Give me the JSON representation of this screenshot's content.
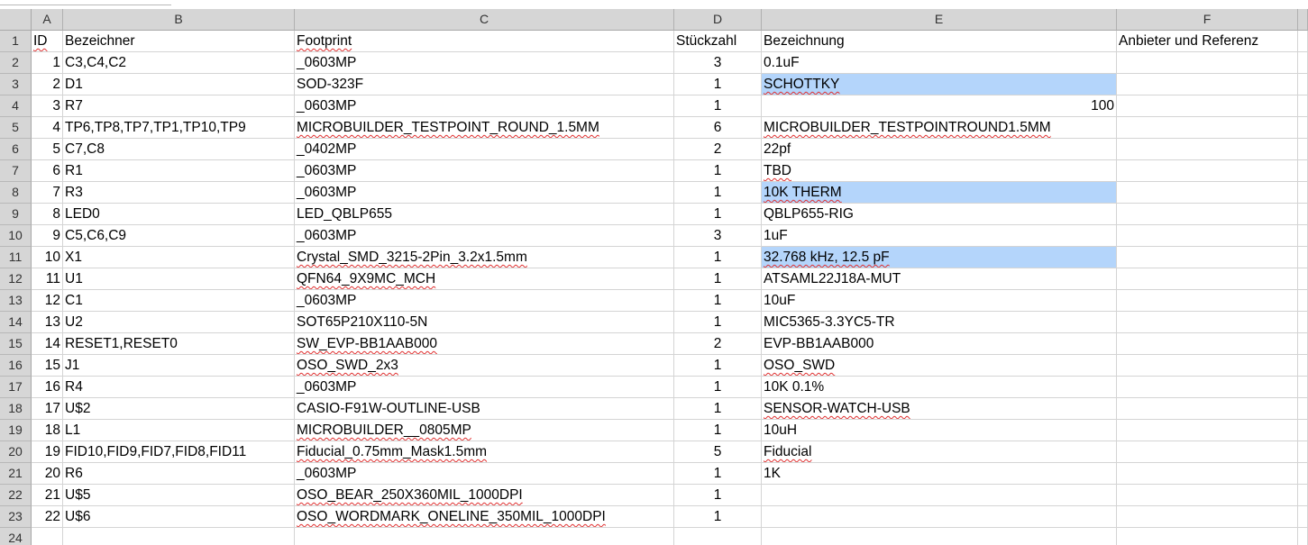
{
  "columns": [
    "A",
    "B",
    "C",
    "D",
    "E",
    "F"
  ],
  "header_row": {
    "num": "1",
    "a": "ID",
    "b": "Bezeichner",
    "c": "Footprint",
    "d": "Stückzahl",
    "e": "Bezeichnung",
    "f": "Anbieter und Referenz"
  },
  "rows": [
    {
      "num": "2",
      "a": "1",
      "b": "C3,C4,C2",
      "c": "_0603MP",
      "d": "3",
      "e": "0.1uF"
    },
    {
      "num": "3",
      "a": "2",
      "b": "D1",
      "c": "SOD-323F",
      "d": "1",
      "e": "SCHOTTKY"
    },
    {
      "num": "4",
      "a": "3",
      "b": "R7",
      "c": "_0603MP",
      "d": "1",
      "e": "100"
    },
    {
      "num": "5",
      "a": "4",
      "b": "TP6,TP8,TP7,TP1,TP10,TP9",
      "c": "MICROBUILDER_TESTPOINT_ROUND_1.5MM",
      "d": "6",
      "e": "MICROBUILDER_TESTPOINTROUND1.5MM"
    },
    {
      "num": "6",
      "a": "5",
      "b": "C7,C8",
      "c": "_0402MP",
      "d": "2",
      "e": "22pf"
    },
    {
      "num": "7",
      "a": "6",
      "b": "R1",
      "c": "_0603MP",
      "d": "1",
      "e": "TBD"
    },
    {
      "num": "8",
      "a": "7",
      "b": "R3",
      "c": "_0603MP",
      "d": "1",
      "e": "10K THERM"
    },
    {
      "num": "9",
      "a": "8",
      "b": "LED0",
      "c": "LED_QBLP655",
      "d": "1",
      "e": "QBLP655-RIG"
    },
    {
      "num": "10",
      "a": "9",
      "b": "C5,C6,C9",
      "c": "_0603MP",
      "d": "3",
      "e": "1uF"
    },
    {
      "num": "11",
      "a": "10",
      "b": "X1",
      "c": "Crystal_SMD_3215-2Pin_3.2x1.5mm",
      "d": "1",
      "e": "32.768 kHz, 12.5 pF"
    },
    {
      "num": "12",
      "a": "11",
      "b": "U1",
      "c": "QFN64_9X9MC_MCH",
      "d": "1",
      "e": "ATSAML22J18A-MUT"
    },
    {
      "num": "13",
      "a": "12",
      "b": "C1",
      "c": "_0603MP",
      "d": "1",
      "e": "10uF"
    },
    {
      "num": "14",
      "a": "13",
      "b": "U2",
      "c": "SOT65P210X110-5N",
      "d": "1",
      "e": "MIC5365-3.3YC5-TR"
    },
    {
      "num": "15",
      "a": "14",
      "b": "RESET1,RESET0",
      "c": "SW_EVP-BB1AAB000",
      "d": "2",
      "e": "EVP-BB1AAB000"
    },
    {
      "num": "16",
      "a": "15",
      "b": "J1",
      "c": "OSO_SWD_2x3",
      "d": "1",
      "e": "OSO_SWD"
    },
    {
      "num": "17",
      "a": "16",
      "b": "R4",
      "c": "_0603MP",
      "d": "1",
      "e": "10K 0.1%"
    },
    {
      "num": "18",
      "a": "17",
      "b": "U$2",
      "c": "CASIO-F91W-OUTLINE-USB",
      "d": "1",
      "e": "SENSOR-WATCH-USB"
    },
    {
      "num": "19",
      "a": "18",
      "b": "L1",
      "c": "MICROBUILDER__0805MP",
      "d": "1",
      "e": "10uH"
    },
    {
      "num": "20",
      "a": "19",
      "b": "FID10,FID9,FID7,FID8,FID11",
      "c": "Fiducial_0.75mm_Mask1.5mm",
      "d": "5",
      "e": "Fiducial"
    },
    {
      "num": "21",
      "a": "20",
      "b": "R6",
      "c": "_0603MP",
      "d": "1",
      "e": "1K"
    },
    {
      "num": "22",
      "a": "21",
      "b": "U$5",
      "c": "OSO_BEAR_250X360MIL_1000DPI",
      "d": "1",
      "e": ""
    },
    {
      "num": "23",
      "a": "22",
      "b": "U$6",
      "c": "OSO_WORDMARK_ONELINE_350MIL_1000DPI",
      "d": "1",
      "e": ""
    },
    {
      "num": "24",
      "a": "",
      "b": "",
      "c": "",
      "d": "",
      "e": ""
    }
  ],
  "colors": {
    "header_bg": "#d6d6d6",
    "grid": "#d4d4d4",
    "highlight": "#b4d5fb",
    "spellcheck": "#e03030"
  }
}
